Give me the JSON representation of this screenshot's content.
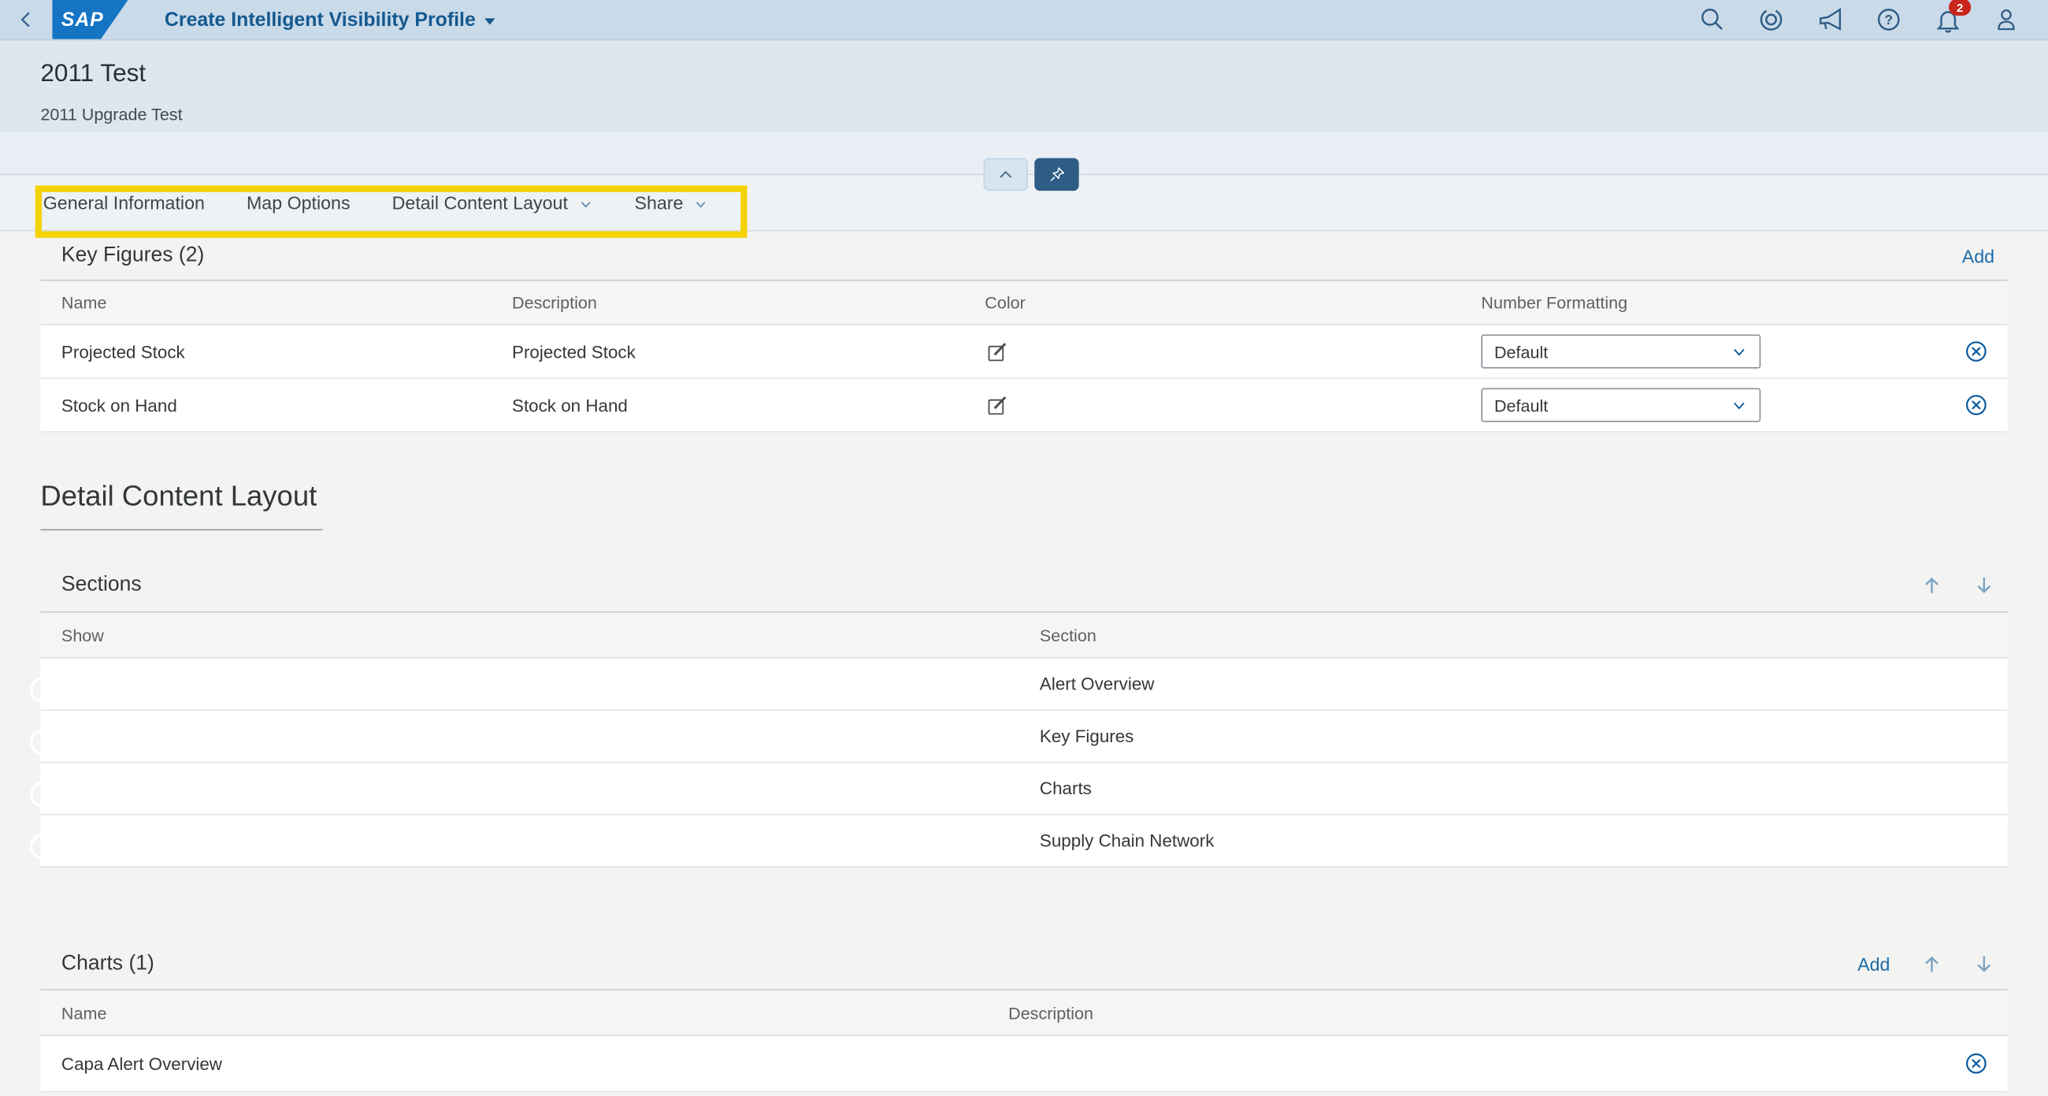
{
  "shell": {
    "logo_text": "SAP",
    "title": "Create Intelligent Visibility Profile",
    "notification_count": "2",
    "help_glyph": "?",
    "icons": [
      "back-icon",
      "search-icon",
      "copilot-icon",
      "megaphone-icon",
      "help-icon",
      "bell-icon",
      "person-icon"
    ]
  },
  "page_header": {
    "title": "2011 Test",
    "subtitle": "2011 Upgrade Test"
  },
  "header_controls": {
    "collapse_icon": "chevron-up-icon",
    "pin_icon": "pin-icon"
  },
  "anchor_tabs": [
    {
      "label": "General Information",
      "has_menu": false
    },
    {
      "label": "Map Options",
      "has_menu": false
    },
    {
      "label": "Detail Content Layout",
      "has_menu": true
    },
    {
      "label": "Share",
      "has_menu": true
    }
  ],
  "key_figures": {
    "title": "Key Figures (2)",
    "add_label": "Add",
    "columns": [
      "Name",
      "Description",
      "Color",
      "Number Formatting"
    ],
    "rows": [
      {
        "name": "Projected Stock",
        "description": "Projected Stock",
        "number_formatting": "Default"
      },
      {
        "name": "Stock on Hand",
        "description": "Stock on Hand",
        "number_formatting": "Default"
      }
    ]
  },
  "detail_content_layout": {
    "heading": "Detail Content Layout",
    "sections": {
      "title": "Sections",
      "columns": [
        "Show",
        "Section"
      ],
      "rows": [
        {
          "label": "Alert Overview",
          "show": true
        },
        {
          "label": "Key Figures",
          "show": true
        },
        {
          "label": "Charts",
          "show": true
        },
        {
          "label": "Supply Chain Network",
          "show": true
        }
      ]
    },
    "charts": {
      "title": "Charts (1)",
      "add_label": "Add",
      "columns": [
        "Name",
        "Description"
      ],
      "rows": [
        {
          "name": "Capa Alert Overview",
          "description": ""
        }
      ]
    }
  },
  "colors": {
    "shell_bg": "#c9dae9",
    "accent_blue": "#0a5aa0",
    "link_blue": "#1b6ca8",
    "toggle_on": "#2e5c85",
    "highlight_yellow": "#f5d201",
    "notification_red": "#c8251c",
    "content_bg": "#f3f4f1"
  }
}
